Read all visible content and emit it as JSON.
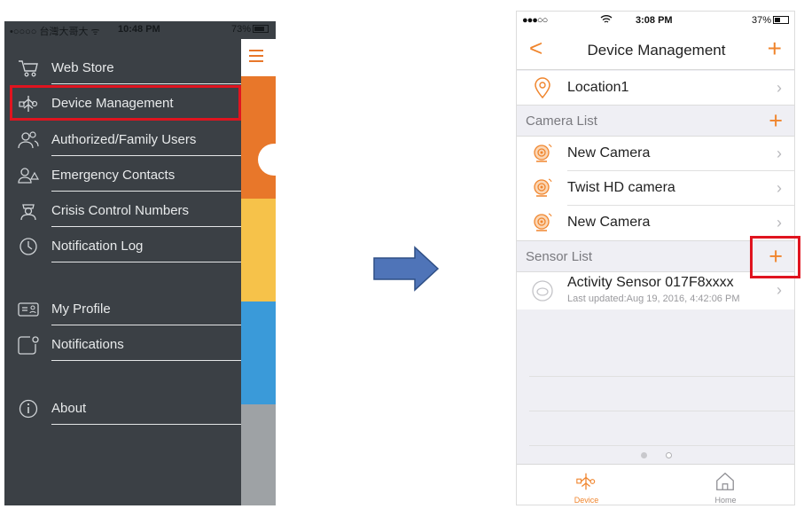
{
  "left_screen": {
    "status_bar": {
      "carrier": "•○○○○ 台灣大哥大 ᯤ",
      "time": "10:48 PM",
      "battery": "73%"
    },
    "menu_items": [
      {
        "icon": "cart-icon",
        "label": "Web Store"
      },
      {
        "icon": "device-icon",
        "label": "Device Management"
      },
      {
        "icon": "users-icon",
        "label": "Authorized/Family Users"
      },
      {
        "icon": "contacts-alert-icon",
        "label": "Emergency Contacts"
      },
      {
        "icon": "officer-icon",
        "label": "Crisis Control Numbers"
      },
      {
        "icon": "clock-icon",
        "label": "Notification Log"
      },
      {
        "icon": "profile-card-icon",
        "label": "My Profile"
      },
      {
        "icon": "notification-icon",
        "label": "Notifications"
      },
      {
        "icon": "info-icon",
        "label": "About"
      }
    ],
    "highlighted_item": "Device Management"
  },
  "arrow": {
    "direction": "right",
    "color": "#4f74b8"
  },
  "right_screen": {
    "status_bar": {
      "carrier": "●●●○○",
      "time": "3:08 PM",
      "battery": "37%"
    },
    "nav": {
      "title": "Device Management",
      "back_icon": "back-chevron-icon",
      "add_icon": "plus-icon"
    },
    "location": {
      "label": "Location1"
    },
    "camera_section": {
      "title": "Camera List"
    },
    "cameras": [
      {
        "label": "New Camera"
      },
      {
        "label": "Twist HD camera"
      },
      {
        "label": "New Camera"
      }
    ],
    "sensor_section": {
      "title": "Sensor List",
      "highlighted_add": true
    },
    "sensors": [
      {
        "label": "Activity Sensor 017F8xxxx",
        "sublabel": "Last updated:Aug 19, 2016, 4:42:06 PM"
      }
    ],
    "tabs": [
      {
        "label": "Device",
        "active": true
      },
      {
        "label": "Home",
        "active": false
      }
    ]
  },
  "colors": {
    "accent": "#f0852d",
    "highlight": "#e0141f",
    "menu_bg": "#3b4045"
  }
}
